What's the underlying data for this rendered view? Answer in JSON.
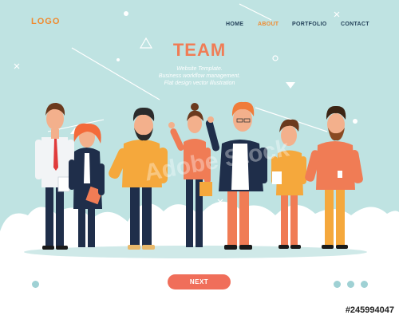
{
  "header": {
    "logo": "LOGO",
    "nav": [
      "HOME",
      "ABOUT",
      "PORTFOLIO",
      "CONTACT"
    ],
    "active_nav": "ABOUT"
  },
  "hero": {
    "title": "TEAM",
    "subtitle_lines": [
      "Website Template.",
      "Business workflow management.",
      "Flat design vector illustration"
    ],
    "watermark": "Adobe Stock"
  },
  "footer": {
    "next_label": "NEXT",
    "stock_id": "#245994047"
  },
  "colors": {
    "background": "#bfe3e2",
    "accent": "#f08a2e",
    "title": "#f07c55",
    "button": "#f06e5a",
    "nav_text": "#24425a"
  },
  "people": [
    {
      "name": "man-white-shirt-tie"
    },
    {
      "name": "woman-redhead-business"
    },
    {
      "name": "bearded-man-yellow-sweater"
    },
    {
      "name": "woman-red-top-waving"
    },
    {
      "name": "man-dark-jacket-pink-pants"
    },
    {
      "name": "young-man-yellow-shirt"
    },
    {
      "name": "bearded-man-coral-sweater"
    }
  ]
}
